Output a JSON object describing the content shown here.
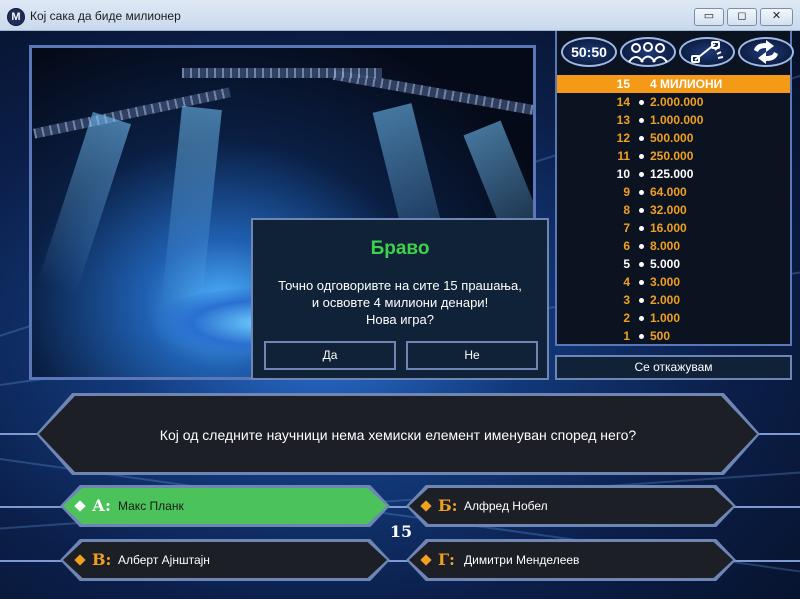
{
  "window": {
    "icon_letter": "M",
    "title": "Кој сака да биде милионер",
    "min_glyph": "▭",
    "max_glyph": "◻",
    "close_glyph": "✕"
  },
  "lifelines": {
    "fifty_fifty": "50:50",
    "audience_icon": "audience-icon",
    "phone_icon": "phone-icon",
    "switch_icon": "switch-question-icon"
  },
  "ladder": [
    {
      "num": "15",
      "amount": "4 МИЛИОНИ",
      "milestone": true,
      "current": true
    },
    {
      "num": "14",
      "amount": "2.000.000",
      "milestone": false
    },
    {
      "num": "13",
      "amount": "1.000.000",
      "milestone": false
    },
    {
      "num": "12",
      "amount": "500.000",
      "milestone": false
    },
    {
      "num": "11",
      "amount": "250.000",
      "milestone": false
    },
    {
      "num": "10",
      "amount": "125.000",
      "milestone": true
    },
    {
      "num": "9",
      "amount": "64.000",
      "milestone": false
    },
    {
      "num": "8",
      "amount": "32.000",
      "milestone": false
    },
    {
      "num": "7",
      "amount": "16.000",
      "milestone": false
    },
    {
      "num": "6",
      "amount": "8.000",
      "milestone": false
    },
    {
      "num": "5",
      "amount": "5.000",
      "milestone": true
    },
    {
      "num": "4",
      "amount": "3.000",
      "milestone": false
    },
    {
      "num": "3",
      "amount": "2.000",
      "milestone": false
    },
    {
      "num": "2",
      "amount": "1.000",
      "milestone": false
    },
    {
      "num": "1",
      "amount": "500",
      "milestone": false
    }
  ],
  "walkaway_label": "Се откажувам",
  "dialog": {
    "title": "Браво",
    "message": "Точно одговоривте на сите 15 прашања,\nи освовте 4 милиони денари!\nНова игра?",
    "yes_label": "Да",
    "no_label": "Не"
  },
  "question": "Кој од следните научници нема хемиски елемент именуван според него?",
  "answers": [
    {
      "letter": "А:",
      "text": "Макс Планк",
      "correct": true
    },
    {
      "letter": "Б:",
      "text": "Алфред Нобел",
      "correct": false
    },
    {
      "letter": "В:",
      "text": "Алберт Ајнштајн",
      "correct": false
    },
    {
      "letter": "Г:",
      "text": "Димитри Менделеев",
      "correct": false
    }
  ],
  "timer": "15",
  "colors": {
    "accent_orange": "#f59a16",
    "correct_green": "#4cc35a",
    "title_green": "#3fd14a",
    "border_blue": "#6f86b5"
  }
}
